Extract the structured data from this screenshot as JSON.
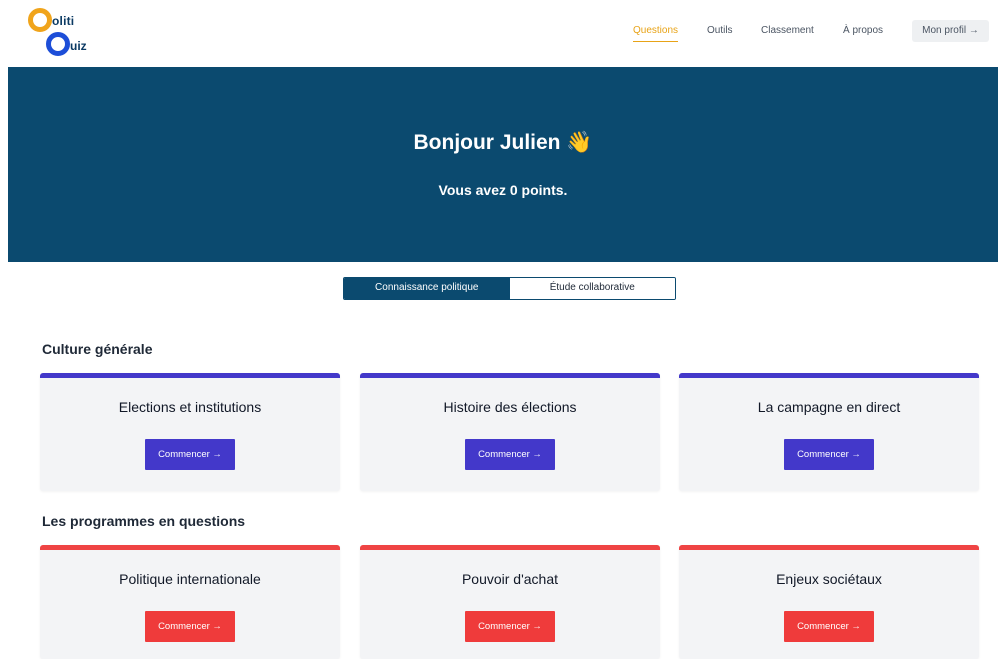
{
  "logo": {
    "line1": "oliti",
    "line2": "uiz"
  },
  "nav": {
    "items": [
      {
        "label": "Questions"
      },
      {
        "label": "Outils"
      },
      {
        "label": "Classement"
      },
      {
        "label": "À propos"
      }
    ],
    "profile": "Mon profil →"
  },
  "hero": {
    "greeting": "Bonjour Julien 👋",
    "points": "Vous avez 0 points."
  },
  "toggle": {
    "selected": "Connaissance politique",
    "other": "Étude collaborative"
  },
  "sections": [
    {
      "title": "Culture générale",
      "cards": [
        {
          "title": "Elections et institutions",
          "button": "Commencer →"
        },
        {
          "title": "Histoire des élections",
          "button": "Commencer →"
        },
        {
          "title": "La campagne en direct",
          "button": "Commencer →"
        }
      ]
    },
    {
      "title": "Les programmes en questions",
      "cards": [
        {
          "title": "Politique internationale",
          "button": "Commencer →"
        },
        {
          "title": "Pouvoir d'achat",
          "button": "Commencer →"
        },
        {
          "title": "Enjeux sociétaux",
          "button": "Commencer →"
        }
      ]
    }
  ],
  "colors": {
    "hero": "#0b4a6f",
    "accent_nav": "#e8a317",
    "section1": "#4338ca",
    "section2": "#ef4444"
  }
}
